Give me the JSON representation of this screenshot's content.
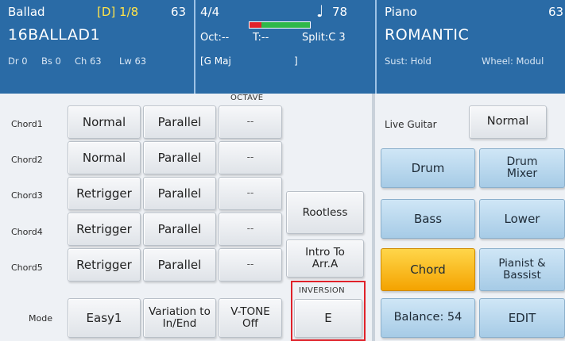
{
  "header": {
    "style": {
      "name": "Ballad",
      "position": "[D] 1/8",
      "number": "63",
      "big_name": "16BALLAD1",
      "dr": "Dr 0",
      "bs": "Bs 0",
      "ch": "Ch 63",
      "lw": "Lw 63"
    },
    "transport": {
      "time_sig": "4/4",
      "note_icon": "♩",
      "tempo": "78",
      "oct": "Oct:--",
      "transpose": "T:--",
      "split": "Split:C 3",
      "chord_display": "[G Maj",
      "chord_close": "]"
    },
    "meter_colors": [
      "#e0222a",
      "#2fb84a",
      "#2fb84a",
      "#2fb84a",
      "#2fb84a"
    ],
    "voice": {
      "category": "Piano",
      "number": "63",
      "name": "ROMANTIC",
      "sustain": "Sust: Hold",
      "wheel": "Wheel: Modul"
    }
  },
  "settings": {
    "column_caption": "OCTAVE",
    "rows": [
      {
        "label": "Chord1",
        "col1": "Normal",
        "col2": "Parallel",
        "col3": "--"
      },
      {
        "label": "Chord2",
        "col1": "Normal",
        "col2": "Parallel",
        "col3": "--"
      },
      {
        "label": "Chord3",
        "col1": "Retrigger",
        "col2": "Parallel",
        "col3": "--"
      },
      {
        "label": "Chord4",
        "col1": "Retrigger",
        "col2": "Parallel",
        "col3": "--"
      },
      {
        "label": "Chord5",
        "col1": "Retrigger",
        "col2": "Parallel",
        "col3": "--"
      }
    ],
    "rootless": "Rootless",
    "intro_to_arr": "Intro To Arr.A",
    "mode": {
      "label": "Mode",
      "easy": "Easy1",
      "variation": "Variation to In/End",
      "vtone": "V-TONE Off"
    },
    "inversion": {
      "caption": "INVERSION",
      "value": "E"
    }
  },
  "right_panel": {
    "live_guitar_label": "Live Guitar",
    "live_guitar_value": "Normal",
    "buttons": {
      "drum": "Drum",
      "drum_mixer": "Drum Mixer",
      "bass": "Bass",
      "lower": "Lower",
      "chord": "Chord",
      "pianist_bassist": "Pianist & Bassist",
      "balance": "Balance: 54",
      "edit": "EDIT"
    },
    "active_button": "chord"
  },
  "colors": {
    "header_bg": "#2a6ba6",
    "active_yellow": "#f4a300",
    "highlight_red": "#e0222a"
  }
}
